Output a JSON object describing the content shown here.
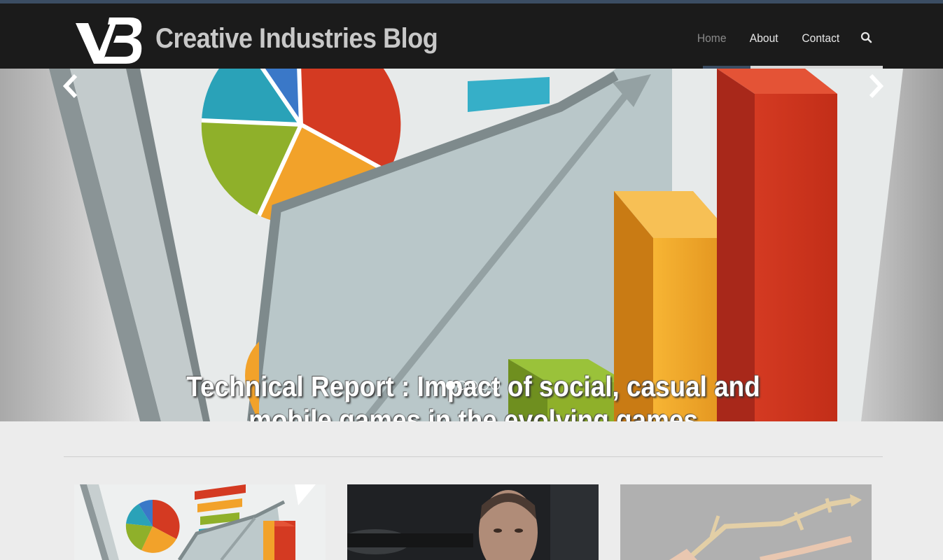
{
  "site": {
    "title": "Creative Industries Blog",
    "logo_text": "VB"
  },
  "nav": [
    {
      "label": "Home",
      "active": true
    },
    {
      "label": "About",
      "active": false
    },
    {
      "label": "Contact",
      "active": false
    }
  ],
  "search_icon": "search-icon",
  "hero": {
    "caption": "Technical Report : Impact of social, casual and mobile games in the evolving games",
    "slide_count": 5,
    "active_slide": 1,
    "prev_icon": "chevron-left-icon",
    "next_icon": "chevron-right-icon"
  },
  "colors": {
    "navbar": "#1b1b1b",
    "accent": "#3b4d63",
    "pie_red": "#d43a22",
    "pie_orange": "#f2a22a",
    "pie_green": "#8fb02a",
    "pie_teal": "#2aa2b8",
    "pie_blue": "#3a78c8"
  },
  "cards": [
    {
      "image": "chart-illustration"
    },
    {
      "image": "man-with-gun-photo"
    },
    {
      "image": "growth-arrow-photo"
    }
  ]
}
